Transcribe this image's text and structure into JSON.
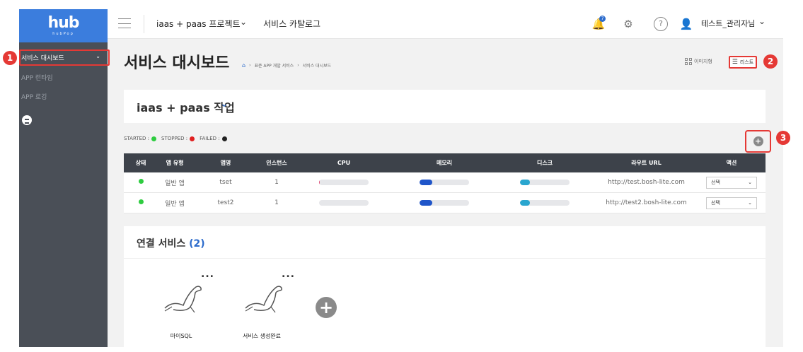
{
  "logo": {
    "main": "hub",
    "sub": "hubPop"
  },
  "sidebar": {
    "items": [
      {
        "label": "서비스 대시보드",
        "active": true
      },
      {
        "label": "APP 런타임"
      },
      {
        "label": "APP 로깅"
      }
    ],
    "exit_icon": "logout-icon"
  },
  "topbar": {
    "project": "iaas + paas 프로젝트",
    "catalog": "서비스 카탈로그",
    "notification_count": "7",
    "username": "테스트_관리자님"
  },
  "page": {
    "title": "서비스 대시보드",
    "breadcrumb": [
      "표준 APP 개발 서비스",
      "서비스 대시보드"
    ],
    "view_image": "이미지형",
    "view_list": "리스트"
  },
  "workspace": {
    "title": "iaas + paas 작업"
  },
  "legend": {
    "started": "STARTED :",
    "stopped": "STOPPED :",
    "failed": "FAILED :",
    "colors": {
      "started": "#2ecc40",
      "stopped": "#e02020",
      "failed": "#222222"
    }
  },
  "table": {
    "headers": [
      "상태",
      "앱 유형",
      "앱명",
      "인스턴스",
      "CPU",
      "메모리",
      "디스크",
      "라우트 URL",
      "액션"
    ],
    "rows": [
      {
        "status": "started",
        "type": "일반 앱",
        "name": "tset",
        "instances": "1",
        "cpu": 0.01,
        "memory": 0.25,
        "disk": 0.2,
        "route": "http://test.bosh-lite.com",
        "action": "선택"
      },
      {
        "status": "started",
        "type": "일반 앱",
        "name": "test2",
        "instances": "1",
        "cpu": 0.0,
        "memory": 0.25,
        "disk": 0.2,
        "route": "http://test2.bosh-lite.com",
        "action": "선택"
      }
    ]
  },
  "connected": {
    "title": "연결 서비스",
    "count": "(2)",
    "services": [
      {
        "name": "마이SQL",
        "more": "..."
      },
      {
        "name": "서비스 생성완료",
        "more": "..."
      }
    ]
  },
  "annotations": [
    "1",
    "2",
    "3"
  ],
  "colors": {
    "accent": "#2d6ccc",
    "sidebar": "#4a4f57",
    "header_dark": "#3d424a",
    "annotation": "#e53935",
    "memory": "#1f55c9",
    "disk": "#2aa6cf"
  }
}
